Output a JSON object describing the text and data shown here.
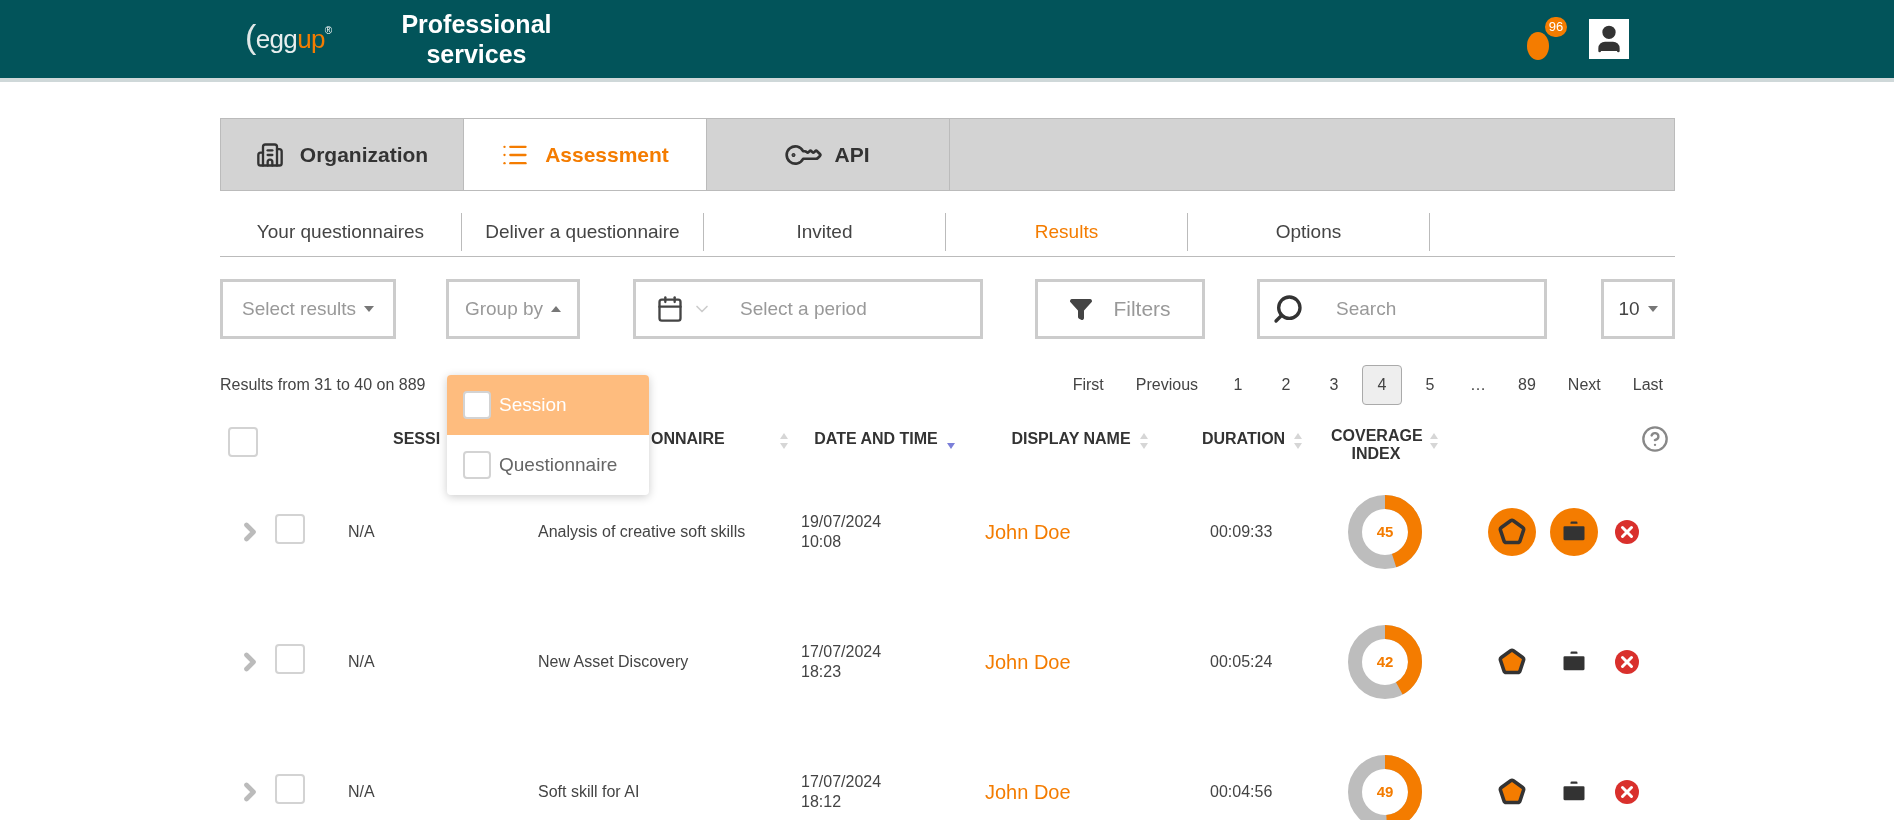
{
  "header": {
    "logo": {
      "paren": "(",
      "text_a": "egg",
      "text_b": "up",
      "mark": "®"
    },
    "title": "Professional services",
    "notifications": {
      "count": "96"
    }
  },
  "tabs": [
    {
      "label": "Organization",
      "selected": false
    },
    {
      "label": "Assessment",
      "selected": true
    },
    {
      "label": "API",
      "selected": false
    }
  ],
  "subtabs": [
    {
      "label": "Your questionnaires",
      "selected": false
    },
    {
      "label": "Deliver a questionnaire",
      "selected": false
    },
    {
      "label": "Invited",
      "selected": false
    },
    {
      "label": "Results",
      "selected": true
    },
    {
      "label": "Options",
      "selected": false
    }
  ],
  "filters": {
    "select_results": "Select results",
    "group_by": {
      "label": "Group by",
      "expanded": true,
      "options": [
        {
          "label": "Session",
          "selected": true,
          "checked": false
        },
        {
          "label": "Questionnaire",
          "selected": false,
          "checked": false
        }
      ]
    },
    "period": {
      "placeholder": "Select a period"
    },
    "filters_button": "Filters",
    "search": {
      "placeholder": "Search"
    },
    "page_size": "10"
  },
  "summary": "Results from 31 to 40 on 889",
  "pagination": [
    {
      "label": "First",
      "selected": false
    },
    {
      "label": "Previous",
      "selected": false
    },
    {
      "label": "1",
      "selected": false
    },
    {
      "label": "2",
      "selected": false
    },
    {
      "label": "3",
      "selected": false
    },
    {
      "label": "4",
      "selected": true
    },
    {
      "label": "5",
      "selected": false
    },
    {
      "label": "…",
      "selected": false
    },
    {
      "label": "89",
      "selected": false
    },
    {
      "label": "Next",
      "selected": false
    },
    {
      "label": "Last",
      "selected": false
    }
  ],
  "table": {
    "select_all": {
      "checked": false
    },
    "columns": [
      {
        "label": "SESSI"
      },
      {
        "label": "ONNAIRE",
        "sortable": true
      },
      {
        "label": "DATE AND TIME",
        "sortable": true,
        "sorted": true
      },
      {
        "label": "DISPLAY NAME",
        "sortable": true
      },
      {
        "label": "DURATION",
        "sortable": true
      },
      {
        "label": "COVERAGE INDEX",
        "sortable": true
      }
    ],
    "rows": [
      {
        "checked": false,
        "session": "N/A",
        "questionnaire": "Analysis of creative soft skills",
        "date": "19/07/2024",
        "time": "10:08",
        "display_name": "John Doe",
        "duration": "00:09:33",
        "coverage": "45",
        "level": 0.45,
        "highlighted": true
      },
      {
        "checked": false,
        "session": "N/A",
        "questionnaire": "New Asset Discovery",
        "date": "17/07/2024",
        "time": "18:23",
        "display_name": "John Doe",
        "duration": "00:05:24",
        "coverage": "42",
        "level": 0.42,
        "highlighted": false
      },
      {
        "checked": false,
        "session": "N/A",
        "questionnaire": "Soft skill for AI",
        "date": "17/07/2024",
        "time": "18:12",
        "display_name": "John Doe",
        "duration": "00:04:56",
        "coverage": "49",
        "level": 0.49,
        "highlighted": false
      }
    ]
  }
}
